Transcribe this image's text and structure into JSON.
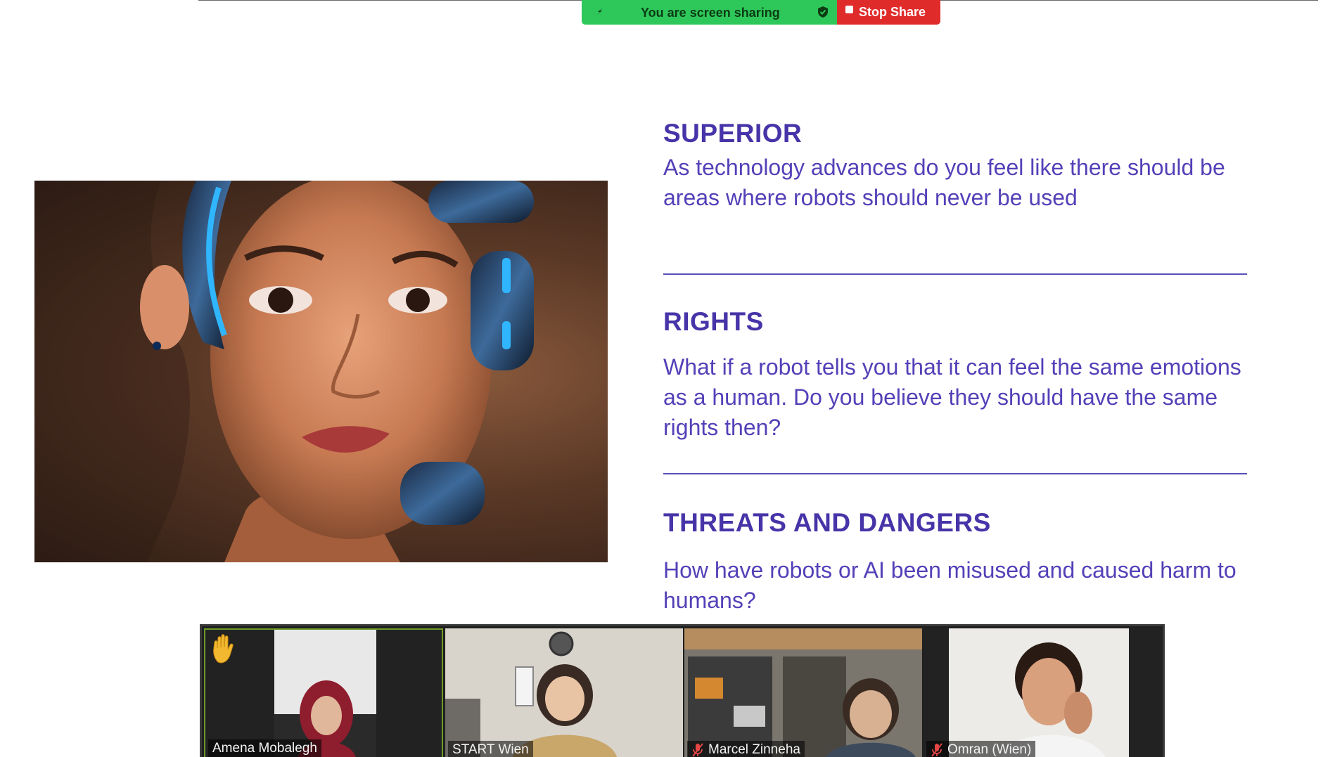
{
  "share_bar": {
    "status_text": "You are screen sharing",
    "stop_label": "Stop Share",
    "status_color": "#2ec85a",
    "stop_color": "#e02b2b"
  },
  "slide": {
    "sections": [
      {
        "heading": "SUPERIOR",
        "body": "As technology advances do you feel like there should be areas where robots should never be used"
      },
      {
        "heading": "RIGHTS",
        "body": "What if a robot tells you that it can feel the same emotions as a human. Do you believe they should have the same rights then?"
      },
      {
        "heading": "THREATS AND DANGERS",
        "body": "How have robots or AI been misused and caused harm to humans?"
      }
    ],
    "accent_color": "#4634a8",
    "image_icon": "robot-woman-portrait"
  },
  "gallery": {
    "participants": [
      {
        "name": "Amena Mobalegh",
        "muted": false,
        "hand_raised": true,
        "active_speaker": true
      },
      {
        "name": "START Wien",
        "muted": false,
        "hand_raised": false,
        "active_speaker": false
      },
      {
        "name": "Marcel Zinneha",
        "muted": true,
        "hand_raised": false,
        "active_speaker": false
      },
      {
        "name": "Omran (Wien)",
        "muted": true,
        "hand_raised": false,
        "active_speaker": false
      }
    ],
    "icons": {
      "hand": "raised-hand-icon",
      "mic": "mic-muted-icon"
    }
  }
}
